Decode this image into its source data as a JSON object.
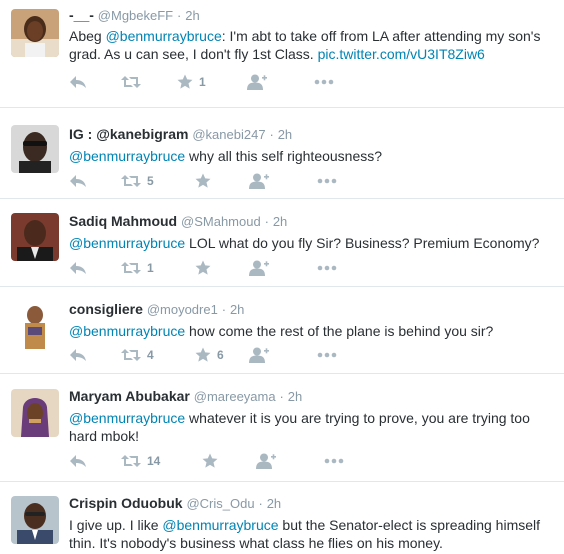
{
  "colors": {
    "link": "#0084b4",
    "meta": "#8899a6",
    "icon": "#aab8c2",
    "text": "#292f33",
    "divider": "#e1e8ed"
  },
  "tweets": [
    {
      "fullname": "-__-",
      "handle": "@MgbekeFF",
      "time": "2h",
      "text_before": "Abeg ",
      "mention": "@benmurraybruce",
      "text_after": ": I'm abt to take off from LA after attending my son's grad. As u can see, I don't fly 1st Class. ",
      "link": "pic.twitter.com/vU3IT8Ziw6",
      "retweet_count": "",
      "favorite_count": "1"
    },
    {
      "fullname": "IG : @kanebigram",
      "handle": "@kanebi247",
      "time": "2h",
      "text_before": "",
      "mention": "@benmurraybruce",
      "text_after": " why all this self righteousness?",
      "link": "",
      "retweet_count": "5",
      "favorite_count": ""
    },
    {
      "fullname": "Sadiq Mahmoud",
      "handle": "@SMahmoud",
      "time": "2h",
      "text_before": "",
      "mention": "@benmurraybruce",
      "text_after": " LOL what do you fly Sir? Business? Premium Economy?",
      "link": "",
      "retweet_count": "1",
      "favorite_count": ""
    },
    {
      "fullname": "consigliere",
      "handle": "@moyodre1",
      "time": "2h",
      "text_before": "",
      "mention": "@benmurraybruce",
      "text_after": " how come the rest of the plane is behind you sir?",
      "link": "",
      "retweet_count": "4",
      "favorite_count": "6"
    },
    {
      "fullname": "Maryam Abubakar",
      "handle": "@mareeyama",
      "time": "2h",
      "text_before": "",
      "mention": "@benmurraybruce",
      "text_after": " whatever it is you are trying to prove, you are trying too hard mbok!",
      "link": "",
      "retweet_count": "14",
      "favorite_count": ""
    },
    {
      "fullname": "Crispin Oduobuk",
      "handle": "@Cris_Odu",
      "time": "2h",
      "text_before": "I give up. I like ",
      "mention": "@benmurraybruce",
      "text_after": " but the Senator-elect is spreading himself thin. It's nobody's business what class he flies on his money.",
      "link": "",
      "retweet_count": "",
      "favorite_count": ""
    }
  ]
}
